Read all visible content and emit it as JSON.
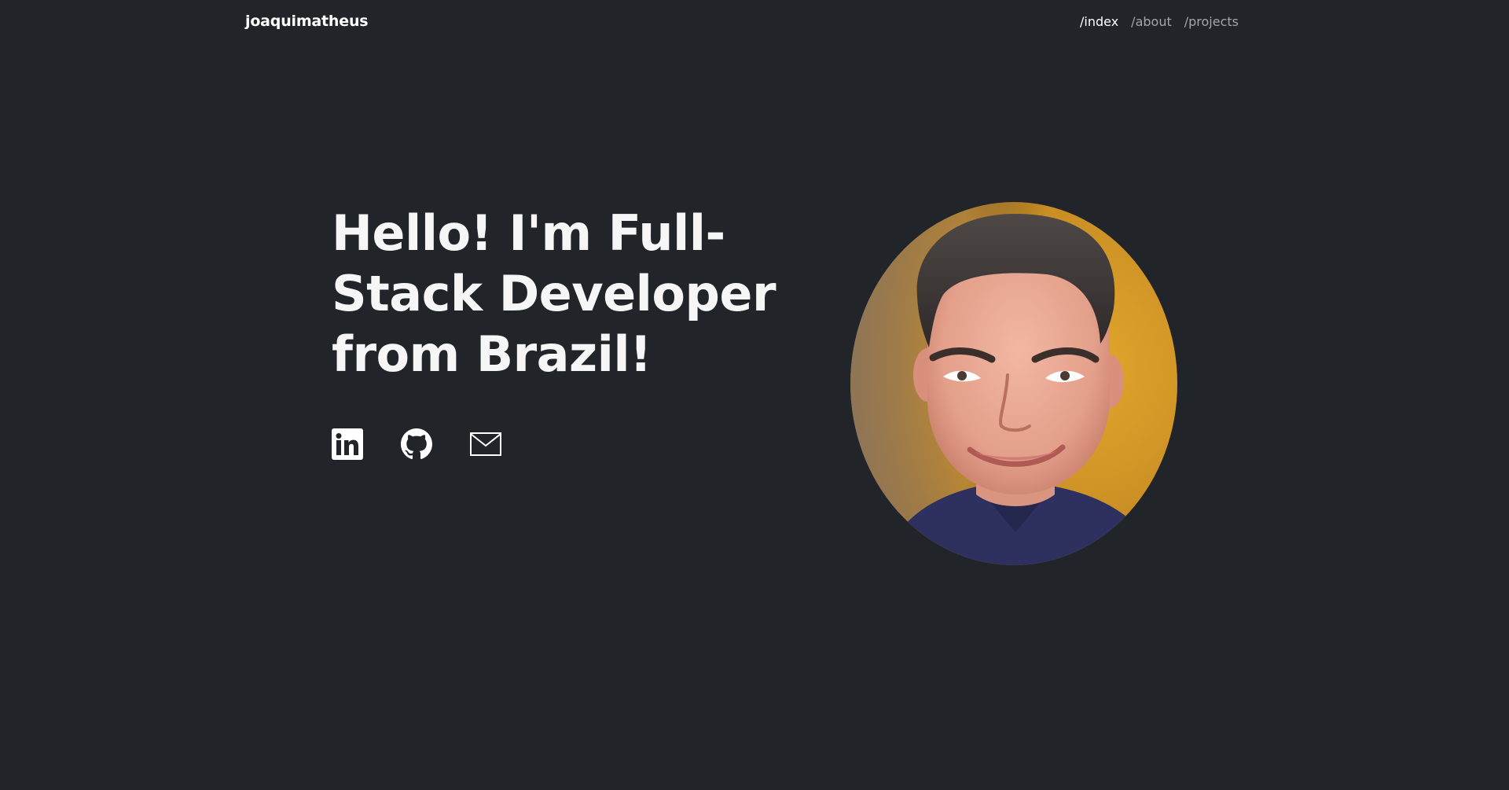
{
  "header": {
    "brand": "joaquimatheus",
    "nav": [
      {
        "label": "/index",
        "active": true
      },
      {
        "label": "/about",
        "active": false
      },
      {
        "label": "/projects",
        "active": false
      }
    ]
  },
  "hero": {
    "title": "Hello! I'm Full-Stack Developer from Brazil!",
    "socials": [
      {
        "icon": "linkedin-icon"
      },
      {
        "icon": "github-icon"
      },
      {
        "icon": "mail-icon"
      }
    ]
  },
  "colors": {
    "background": "#212429",
    "text": "#ffffff",
    "nav_inactive": "#a3a6ab",
    "portrait_background": "#d59a22"
  }
}
